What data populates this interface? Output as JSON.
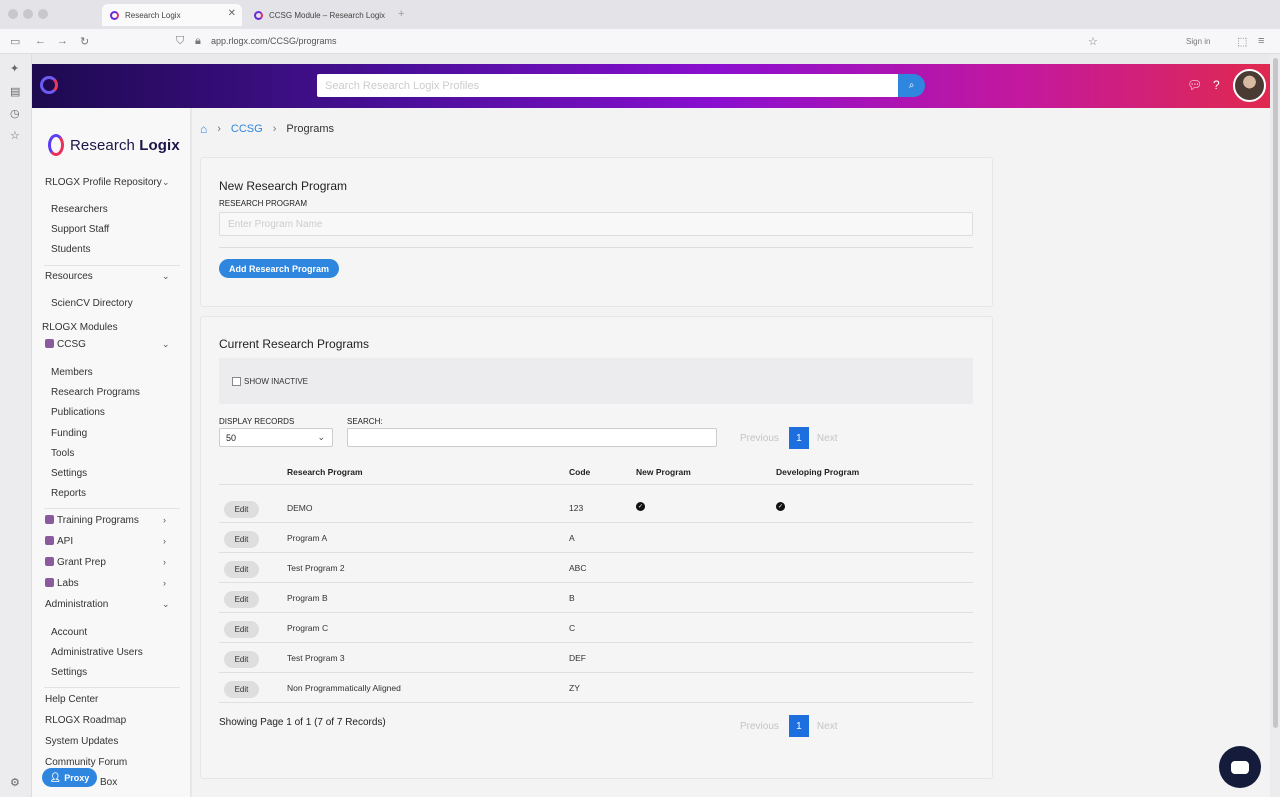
{
  "browser": {
    "tabs": [
      {
        "title": "Research Logix"
      },
      {
        "title": "CCSG Module – Research Logix"
      }
    ],
    "url": "app.rlogx.com/CCSG/programs",
    "sign_in": "Sign in"
  },
  "header": {
    "search_placeholder": "Search Research Logix Profiles"
  },
  "sidebar": {
    "brand": "Research Logix",
    "brand_light": "Research ",
    "brand_bold": "Logix",
    "profile_repo": "RLOGX Profile Repository",
    "profile_items": [
      "Researchers",
      "Support Staff",
      "Students"
    ],
    "resources": "Resources",
    "resources_items": [
      "ScienCV Directory"
    ],
    "modules_label": "RLOGX Modules",
    "ccsg": "CCSG",
    "ccsg_items": [
      "Members",
      "Research Programs",
      "Publications",
      "Funding",
      "Tools",
      "Settings",
      "Reports"
    ],
    "modules": [
      "Training Programs",
      "API",
      "Grant Prep",
      "Labs"
    ],
    "administration": "Administration",
    "admin_items": [
      "Account",
      "Administrative Users",
      "Settings"
    ],
    "footer_links": [
      "Help Center",
      "RLOGX Roadmap",
      "System Updates",
      "Community Forum",
      "Box"
    ],
    "proxy": "Proxy"
  },
  "breadcrumb": {
    "link": "CCSG",
    "current": "Programs"
  },
  "new_program": {
    "title": "New Research Program",
    "label": "RESEARCH PROGRAM",
    "placeholder": "Enter Program Name",
    "button": "Add Research Program"
  },
  "current_programs": {
    "title": "Current Research Programs",
    "show_inactive": "SHOW INACTIVE",
    "display_records_label": "DISPLAY RECORDS",
    "display_records_value": "50",
    "search_label": "SEARCH:",
    "pager": {
      "previous": "Previous",
      "page": "1",
      "next": "Next"
    },
    "columns": [
      "Research Program",
      "Code",
      "New Program",
      "Developing Program"
    ],
    "rows": [
      {
        "edit": "Edit",
        "name": "DEMO",
        "code": "123",
        "new_program": true,
        "developing_program": true
      },
      {
        "edit": "Edit",
        "name": "Program A",
        "code": "A",
        "new_program": false,
        "developing_program": false
      },
      {
        "edit": "Edit",
        "name": "Test Program 2",
        "code": "ABC",
        "new_program": false,
        "developing_program": false
      },
      {
        "edit": "Edit",
        "name": "Program B",
        "code": "B",
        "new_program": false,
        "developing_program": false
      },
      {
        "edit": "Edit",
        "name": "Program C",
        "code": "C",
        "new_program": false,
        "developing_program": false
      },
      {
        "edit": "Edit",
        "name": "Test Program 3",
        "code": "DEF",
        "new_program": false,
        "developing_program": false
      },
      {
        "edit": "Edit",
        "name": "Non Programmatically Aligned",
        "code": "ZY",
        "new_program": false,
        "developing_program": false
      }
    ],
    "showing": "Showing Page 1 of 1 (7 of 7 Records)"
  },
  "colors": {
    "accent": "#2e86de",
    "header_gradient_start": "#1d0a4f",
    "header_gradient_end": "#e0294f",
    "chat_button": "#151b3a"
  }
}
